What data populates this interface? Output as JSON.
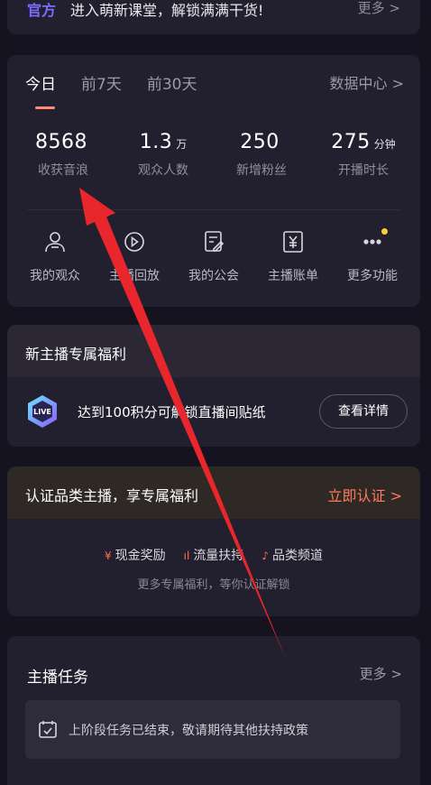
{
  "banner": {
    "tag": "官方",
    "text": "进入萌新课堂，解锁满满干货!",
    "more": "更多 >"
  },
  "stats": {
    "tabs": [
      "今日",
      "前7天",
      "前30天"
    ],
    "data_center": "数据中心 >",
    "metrics": [
      {
        "value": "8568",
        "unit": "",
        "label": "收获音浪"
      },
      {
        "value": "1.3",
        "unit": "万",
        "label": "观众人数"
      },
      {
        "value": "250",
        "unit": "",
        "label": "新增粉丝"
      },
      {
        "value": "275",
        "unit": "分钟",
        "label": "开播时长"
      }
    ],
    "functions": [
      {
        "label": "我的观众",
        "icon": "audience-icon"
      },
      {
        "label": "主播回放",
        "icon": "replay-icon"
      },
      {
        "label": "我的公会",
        "icon": "guild-icon"
      },
      {
        "label": "主播账单",
        "icon": "bill-icon"
      },
      {
        "label": "更多功能",
        "icon": "more-icon"
      }
    ]
  },
  "new_anchor": {
    "title": "新主播专属福利",
    "desc": "达到100积分可解锁直播间贴纸",
    "button": "查看详情",
    "badge_icon": "live-badge-icon"
  },
  "verified": {
    "title": "认证品类主播，享专属福利",
    "action": "立即认证 >",
    "perks": [
      {
        "icon": "¥",
        "label": "现金奖励"
      },
      {
        "icon": "ıl",
        "label": "流量扶持"
      },
      {
        "icon": "♪",
        "label": "品类频道"
      }
    ],
    "sub": "更多专属福利，等你认证解锁"
  },
  "tasks": {
    "title": "主播任务",
    "more": "更多 >",
    "notice": "上阶段任务已结束，敬请期待其他扶持政策"
  },
  "colors": {
    "background": "#15131f",
    "card": "#22202e",
    "accent": "#ff7a5c",
    "annotation_arrow": "#e8262b"
  }
}
